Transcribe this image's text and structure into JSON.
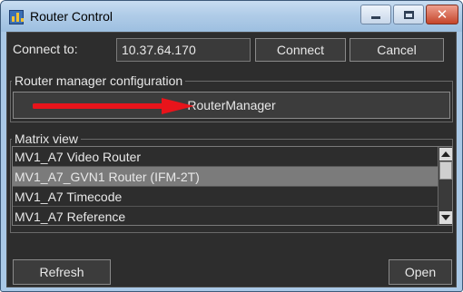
{
  "window": {
    "title": "Router Control"
  },
  "connection": {
    "label": "Connect to:",
    "address": "10.37.64.170",
    "connect_label": "Connect",
    "cancel_label": "Cancel"
  },
  "router_manager": {
    "group_title": "Router manager configuration",
    "button_label": "RouterManager",
    "annotation_color": "#e8141b"
  },
  "matrix_view": {
    "group_title": "Matrix view",
    "items": [
      {
        "label": "MV1_A7 Video Router",
        "selected": false
      },
      {
        "label": "MV1_A7_GVN1 Router (IFM-2T)",
        "selected": true
      },
      {
        "label": "MV1_A7 Timecode",
        "selected": false
      },
      {
        "label": "MV1_A7 Reference",
        "selected": false
      }
    ]
  },
  "footer": {
    "refresh_label": "Refresh",
    "open_label": "Open"
  }
}
